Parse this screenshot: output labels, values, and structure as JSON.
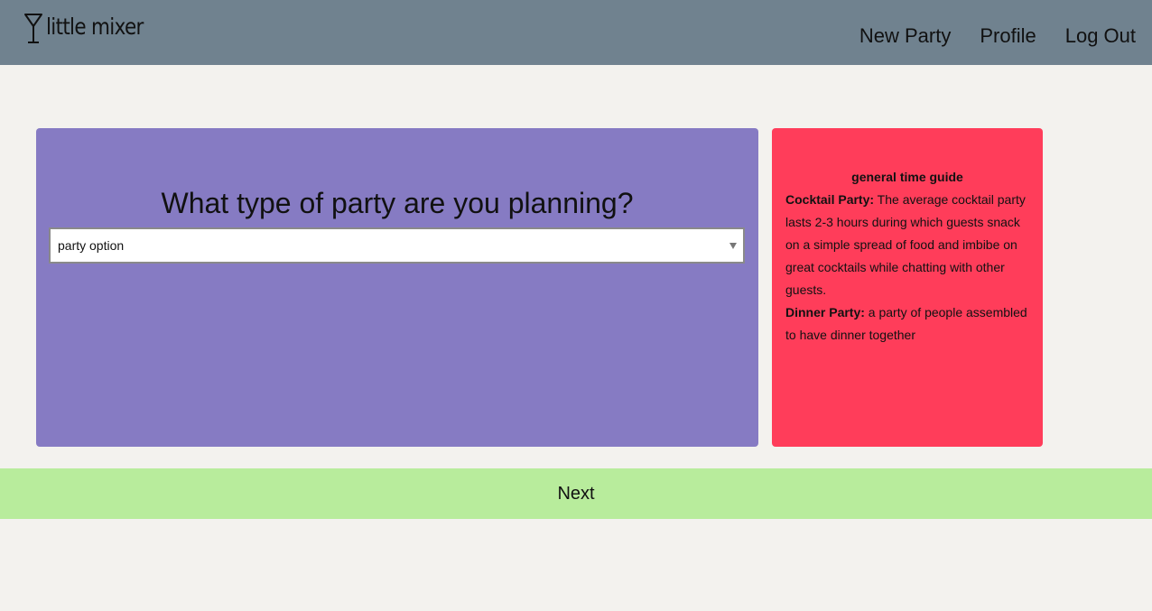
{
  "header": {
    "logo_text": "little mixer",
    "logo_icon": "cocktail-glass-icon",
    "nav": [
      {
        "label": "New Party"
      },
      {
        "label": "Profile"
      },
      {
        "label": "Log Out"
      }
    ]
  },
  "question": {
    "title": "What type of party are you planning?",
    "select": {
      "value": "party option"
    }
  },
  "guide": {
    "title": "general time guide",
    "entries": [
      {
        "term": "Cocktail Party:",
        "text": " The average cocktail party lasts 2-3 hours during which guests snack on a simple spread of food and imbibe on great cocktails while chatting with other guests."
      },
      {
        "term": "Dinner Party:",
        "text": " a party of people assembled to have dinner together"
      }
    ]
  },
  "footer": {
    "next_label": "Next"
  },
  "colors": {
    "navbar": "#70828f",
    "background": "#f3f2ee",
    "question_card": "#867bc3",
    "guide_card": "#ff3d5a",
    "next_bar": "#b8ec9c"
  }
}
